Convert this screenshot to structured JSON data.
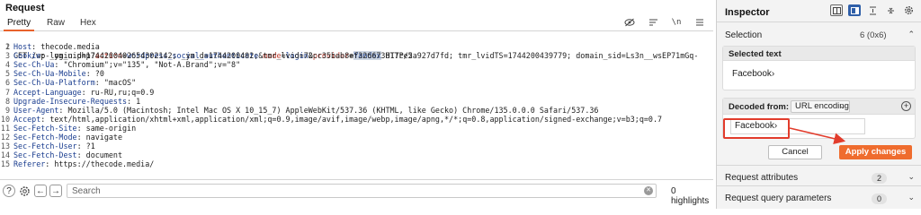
{
  "request": {
    "title": "Request",
    "tabs": [
      {
        "label": "Pretty",
        "active": true
      },
      {
        "label": "Raw",
        "active": false
      },
      {
        "label": "Hex",
        "active": false
      }
    ],
    "lines": [
      {
        "num": "1",
        "text": "GET /wp-login.php?action=wordpress_social_authenticate&mode=login&provider=Yandex HTTP/2"
      },
      {
        "num": "2",
        "name": "Host",
        "value": ": thecode.media"
      },
      {
        "num": "3",
        "name": "Cookie",
        "value": ": _ym_uid=1744200402654302142; _ym_d=1744200402; tmr_lvid=72cc35bab8ef326673817ce5a927d7fd; tmr_lvidTS=1744200439779; domain_sid=Ls3n__wsEP71mGq-"
      },
      {
        "num": "4",
        "name": "Sec-Ch-Ua",
        "value": ": \"Chromium\";v=\"135\", \"Not-A.Brand\";v=\"8\""
      },
      {
        "num": "5",
        "name": "Sec-Ch-Ua-Mobile",
        "value": ": ?0"
      },
      {
        "num": "6",
        "name": "Sec-Ch-Ua-Platform",
        "value": ": \"macOS\""
      },
      {
        "num": "7",
        "name": "Accept-Language",
        "value": ": ru-RU,ru;q=0.9"
      },
      {
        "num": "8",
        "name": "Upgrade-Insecure-Requests",
        "value": ": 1"
      },
      {
        "num": "9",
        "name": "User-Agent",
        "value": ": Mozilla/5.0 (Macintosh; Intel Mac OS X 10_15_7) AppleWebKit/537.36 (KHTML, like Gecko) Chrome/135.0.0.0 Safari/537.36"
      },
      {
        "num": "10",
        "name": "Accept",
        "value": ": text/html,application/xhtml+xml,application/xml;q=0.9,image/avif,image/webp,image/apng,*/*;q=0.8,application/signed-exchange;v=b3;q=0.7"
      },
      {
        "num": "11",
        "name": "Sec-Fetch-Site",
        "value": ": same-origin"
      },
      {
        "num": "12",
        "name": "Sec-Fetch-Mode",
        "value": ": navigate"
      },
      {
        "num": "13",
        "name": "Sec-Fetch-User",
        "value": ": ?1"
      },
      {
        "num": "14",
        "name": "Sec-Fetch-Dest",
        "value": ": document"
      },
      {
        "num": "15",
        "name": "Referer",
        "value": ": https://thecode.media/"
      }
    ],
    "line1": {
      "method": "GET ",
      "path": "/wp-login.php?",
      "p1k": "action",
      "p1v": "wordpress_social_authenticate",
      "p2k": "mode",
      "p2v": "login",
      "p3k": "provider",
      "p3v": "Yandex",
      "proto": " HTTP/2"
    },
    "search": {
      "placeholder": "Search"
    },
    "highlights": "0 highlights",
    "icons": [
      "eye-off-icon",
      "wrap-icon",
      "newline-icon",
      "menu-icon",
      "help-icon",
      "settings-icon",
      "back-icon",
      "forward-icon",
      "clear-icon"
    ]
  },
  "inspector": {
    "title": "Inspector",
    "selection_label": "Selection",
    "selection_count": "6 (0x6)",
    "selected_text_label": "Selected text",
    "selected_text_value": "Facebook›",
    "decoded_from_label": "Decoded from:",
    "encoding": "URL encoding",
    "decoded_value": "Facebook›",
    "cancel_label": "Cancel",
    "apply_label": "Apply changes",
    "request_attributes_label": "Request attributes",
    "request_attributes_count": "2",
    "request_query_label": "Request query parameters",
    "request_query_count": "0"
  },
  "colors": {
    "accent": "#ef6c2e",
    "annotation": "#e23c2c",
    "header_name": "#1a3d8f",
    "param_key": "#c0392b"
  }
}
